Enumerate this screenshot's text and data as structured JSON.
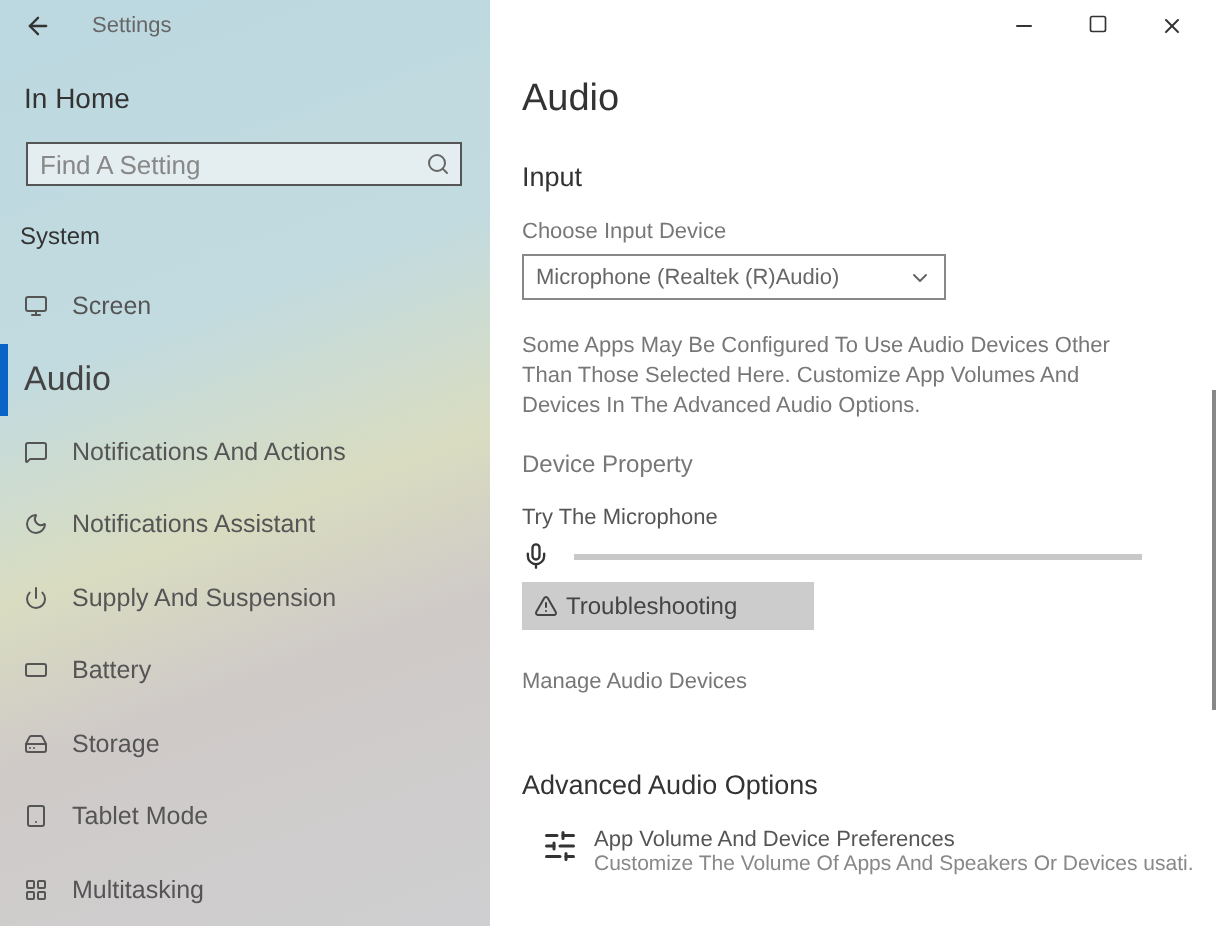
{
  "window": {
    "title": "Settings"
  },
  "sidebar": {
    "home": "In Home",
    "search": {
      "placeholder": "Find A Setting"
    },
    "section": "System",
    "items": [
      {
        "label": "Screen",
        "selected": false
      },
      {
        "label": "Audio",
        "selected": true
      },
      {
        "label": "Notifications And Actions",
        "selected": false
      },
      {
        "label": "Notifications Assistant",
        "selected": false
      },
      {
        "label": "Supply And Suspension",
        "selected": false
      },
      {
        "label": "Battery",
        "selected": false
      },
      {
        "label": "Storage",
        "selected": false
      },
      {
        "label": "Tablet Mode",
        "selected": false
      },
      {
        "label": "Multitasking",
        "selected": false
      }
    ]
  },
  "page": {
    "title": "Audio",
    "input_heading": "Input",
    "device_label": "Choose Input Device",
    "device_value": "Microphone (Realtek (R)Audio)",
    "note": "Some Apps May Be Configured To Use Audio Devices Other Than Those Selected Here. Customize App Volumes And Devices In The Advanced Audio Options.",
    "device_property": "Device Property",
    "test_label": "Try The Microphone",
    "mic_level": {
      "level": 0
    },
    "troubleshoot_button": "Troubleshooting",
    "manage_link": "Manage Audio Devices",
    "advanced_heading": "Advanced Audio Options",
    "advanced_item": {
      "title": "App Volume And Device Preferences",
      "description": "Customize The Volume Of Apps And Speakers Or Devices usati."
    }
  }
}
